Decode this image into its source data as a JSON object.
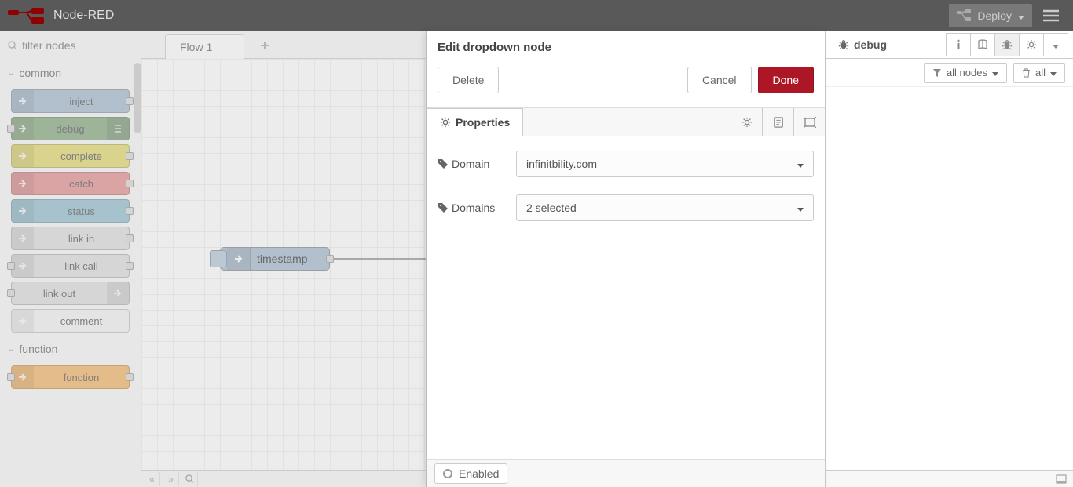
{
  "app": {
    "title": "Node-RED"
  },
  "header": {
    "deploy": "Deploy"
  },
  "palette": {
    "filter_placeholder": "filter nodes",
    "categories": [
      {
        "label": "common",
        "nodes": [
          {
            "label": "inject",
            "class": "n-inject",
            "out": true
          },
          {
            "label": "debug",
            "class": "n-debug",
            "in": true,
            "rightpane": true
          },
          {
            "label": "complete",
            "class": "n-complete",
            "out": true
          },
          {
            "label": "catch",
            "class": "n-catch",
            "out": true
          },
          {
            "label": "status",
            "class": "n-status",
            "out": true
          },
          {
            "label": "link in",
            "class": "n-link",
            "out": true
          },
          {
            "label": "link call",
            "class": "n-link",
            "out": true,
            "in": true
          },
          {
            "label": "link out",
            "class": "n-link",
            "in": true,
            "iconright": true
          },
          {
            "label": "comment",
            "class": "n-comment"
          }
        ]
      },
      {
        "label": "function",
        "nodes": [
          {
            "label": "function",
            "class": "n-function",
            "out": true,
            "in": true
          }
        ]
      }
    ]
  },
  "workspace": {
    "tab": "Flow 1",
    "node_label": "timestamp"
  },
  "tray": {
    "title": "Edit dropdown node",
    "delete": "Delete",
    "cancel": "Cancel",
    "done": "Done",
    "properties": "Properties",
    "fields": {
      "domain_label": "Domain",
      "domain_value": "infinitbility.com",
      "domains_label": "Domains",
      "domains_value": "2 selected"
    },
    "enabled": "Enabled"
  },
  "sidebar": {
    "tab": "debug",
    "filter": "all nodes",
    "clear": "all"
  }
}
